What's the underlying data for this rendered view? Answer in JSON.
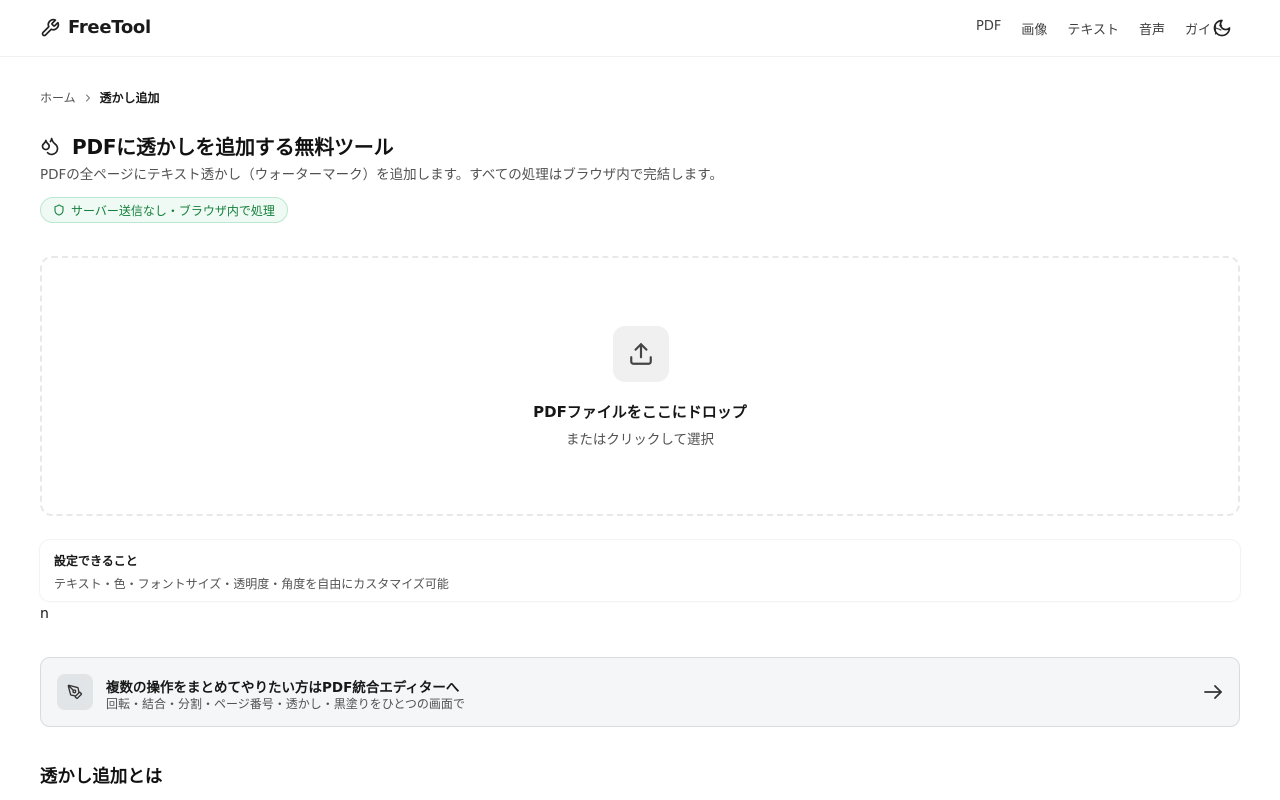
{
  "header": {
    "brand_name": "FreeTool",
    "nav": [
      "PDF",
      "画像",
      "テキスト",
      "音声",
      "ガイド"
    ]
  },
  "breadcrumb": {
    "home": "ホーム",
    "current": "透かし追加"
  },
  "page": {
    "title": "PDFに透かしを追加する無料ツール",
    "subtitle": "PDFの全ページにテキスト透かし（ウォーターマーク）を追加します。すべての処理はブラウザ内で完結します。",
    "privacy_badge": "サーバー送信なし・ブラウザ内で処理"
  },
  "dropzone": {
    "title": "PDFファイルをここにドロップ",
    "subtitle": "またはクリックして選択"
  },
  "info_card": {
    "title": "設定できること",
    "text": "テキスト・色・フォントサイズ・透明度・角度を自由にカスタマイズ可能"
  },
  "stray_text": "n",
  "editor_cta": {
    "title": "複数の操作をまとめてやりたい方はPDF統合エディターへ",
    "subtitle": "回転・結合・分割・ページ番号・透かし・黒塗りをひとつの画面で"
  },
  "section": {
    "title": "透かし追加とは"
  },
  "colors": {
    "badge_green": "#15803d",
    "badge_bg": "#eefaf3",
    "text_main": "#171717",
    "text_muted": "#525252"
  },
  "icons": {
    "brand": "wrench-icon",
    "theme": "moon-icon",
    "title": "droplets-icon",
    "badge": "shield-icon",
    "upload": "upload-icon",
    "cta": "pen-tool-icon",
    "cta_arrow": "arrow-right-icon"
  }
}
